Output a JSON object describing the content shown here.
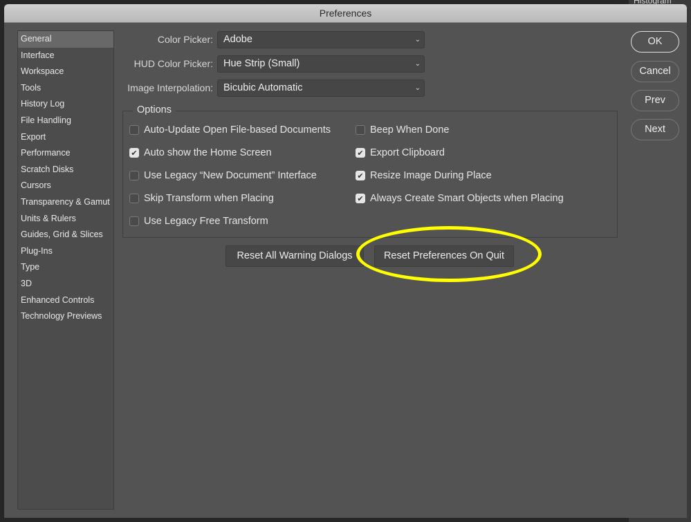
{
  "background": {
    "panel_title": "Histogram"
  },
  "dialog": {
    "title": "Preferences"
  },
  "sidebar": {
    "items": [
      {
        "label": "General",
        "selected": true
      },
      {
        "label": "Interface"
      },
      {
        "label": "Workspace"
      },
      {
        "label": "Tools"
      },
      {
        "label": "History Log"
      },
      {
        "label": "File Handling"
      },
      {
        "label": "Export"
      },
      {
        "label": "Performance"
      },
      {
        "label": "Scratch Disks"
      },
      {
        "label": "Cursors"
      },
      {
        "label": "Transparency & Gamut"
      },
      {
        "label": "Units & Rulers"
      },
      {
        "label": "Guides, Grid & Slices"
      },
      {
        "label": "Plug-Ins"
      },
      {
        "label": "Type"
      },
      {
        "label": "3D"
      },
      {
        "label": "Enhanced Controls"
      },
      {
        "label": "Technology Previews"
      }
    ]
  },
  "fields": [
    {
      "label": "Color Picker:",
      "value": "Adobe"
    },
    {
      "label": "HUD Color Picker:",
      "value": "Hue Strip (Small)"
    },
    {
      "label": "Image Interpolation:",
      "value": "Bicubic Automatic"
    }
  ],
  "options": {
    "title": "Options",
    "items": [
      {
        "label": "Auto-Update Open File-based Documents",
        "checked": false
      },
      {
        "label": "Auto show the Home Screen",
        "checked": true
      },
      {
        "label": "Use Legacy “New Document” Interface",
        "checked": false
      },
      {
        "label": "Skip Transform when Placing",
        "checked": false
      },
      {
        "label": "Use Legacy Free Transform",
        "checked": false
      },
      {
        "label": "Beep When Done",
        "checked": false
      },
      {
        "label": "Export Clipboard",
        "checked": true
      },
      {
        "label": "Resize Image During Place",
        "checked": true
      },
      {
        "label": "Always Create Smart Objects when Placing",
        "checked": true
      }
    ]
  },
  "buttons": {
    "reset_warnings": "Reset All Warning Dialogs",
    "reset_prefs": "Reset Preferences On Quit",
    "ok": "OK",
    "cancel": "Cancel",
    "prev": "Prev",
    "next": "Next"
  },
  "annotation": {
    "color": "#ffff00",
    "highlights": "Reset Preferences On Quit"
  }
}
